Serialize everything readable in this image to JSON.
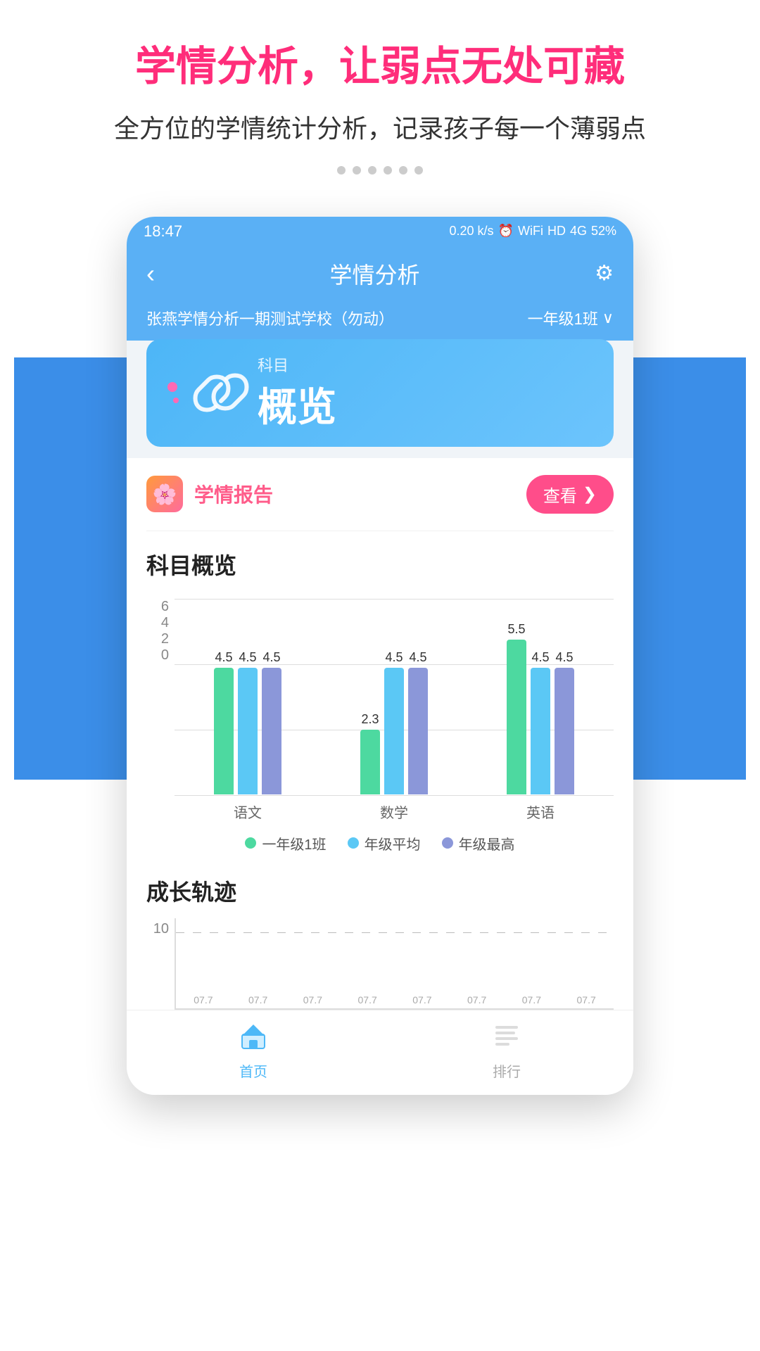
{
  "promo": {
    "title": "学情分析，让弱点无处可藏",
    "subtitle": "全方位的学情统计分析，记录孩子每一个薄弱点"
  },
  "statusBar": {
    "time": "18:47",
    "icons": "0.20 k/s  ⏰  WiFi  HD  4G  HD  4G  52%"
  },
  "navBar": {
    "title": "学情分析",
    "backLabel": "‹",
    "gearLabel": "⚙"
  },
  "schoolRow": {
    "schoolName": "张燕学情分析一期测试学校（勿动）",
    "classLabel": "一年级1班",
    "dropdownIcon": "∨"
  },
  "subjectCard": {
    "smallLabel": "科目",
    "bigLabel": "概览"
  },
  "reportSection": {
    "title": "学情报告",
    "viewLabel": "查看",
    "viewIcon": "❯"
  },
  "subjectOverview": {
    "sectionTitle": "科目概览",
    "yMax": 6,
    "yMid": 4,
    "yLow": 2,
    "yMin": 0,
    "subjects": [
      {
        "name": "语文",
        "bars": [
          {
            "label": "4.5",
            "value": 4.5,
            "type": "green"
          },
          {
            "label": "4.5",
            "value": 4.5,
            "type": "lightblue"
          },
          {
            "label": "4.5",
            "value": 4.5,
            "type": "purple"
          }
        ]
      },
      {
        "name": "数学",
        "bars": [
          {
            "label": "2.3",
            "value": 2.3,
            "type": "green"
          },
          {
            "label": "4.5",
            "value": 4.5,
            "type": "lightblue"
          },
          {
            "label": "4.5",
            "value": 4.5,
            "type": "purple"
          }
        ]
      },
      {
        "name": "英语",
        "bars": [
          {
            "label": "5.5",
            "value": 5.5,
            "type": "green"
          },
          {
            "label": "4.5",
            "value": 4.5,
            "type": "lightblue"
          },
          {
            "label": "4.5",
            "value": 4.5,
            "type": "purple"
          }
        ]
      }
    ],
    "legend": [
      {
        "color": "#4dd9a0",
        "label": "一年级1班"
      },
      {
        "color": "#5bc8f5",
        "label": "年级平均"
      },
      {
        "color": "#8b97d9",
        "label": "年级最高"
      }
    ]
  },
  "growthSection": {
    "sectionTitle": "成长轨迹",
    "yLabel": "10"
  },
  "bottomNav": {
    "items": [
      {
        "icon": "🏠",
        "label": "首页",
        "active": true
      },
      {
        "icon": "📊",
        "label": "排行",
        "active": false
      }
    ]
  }
}
